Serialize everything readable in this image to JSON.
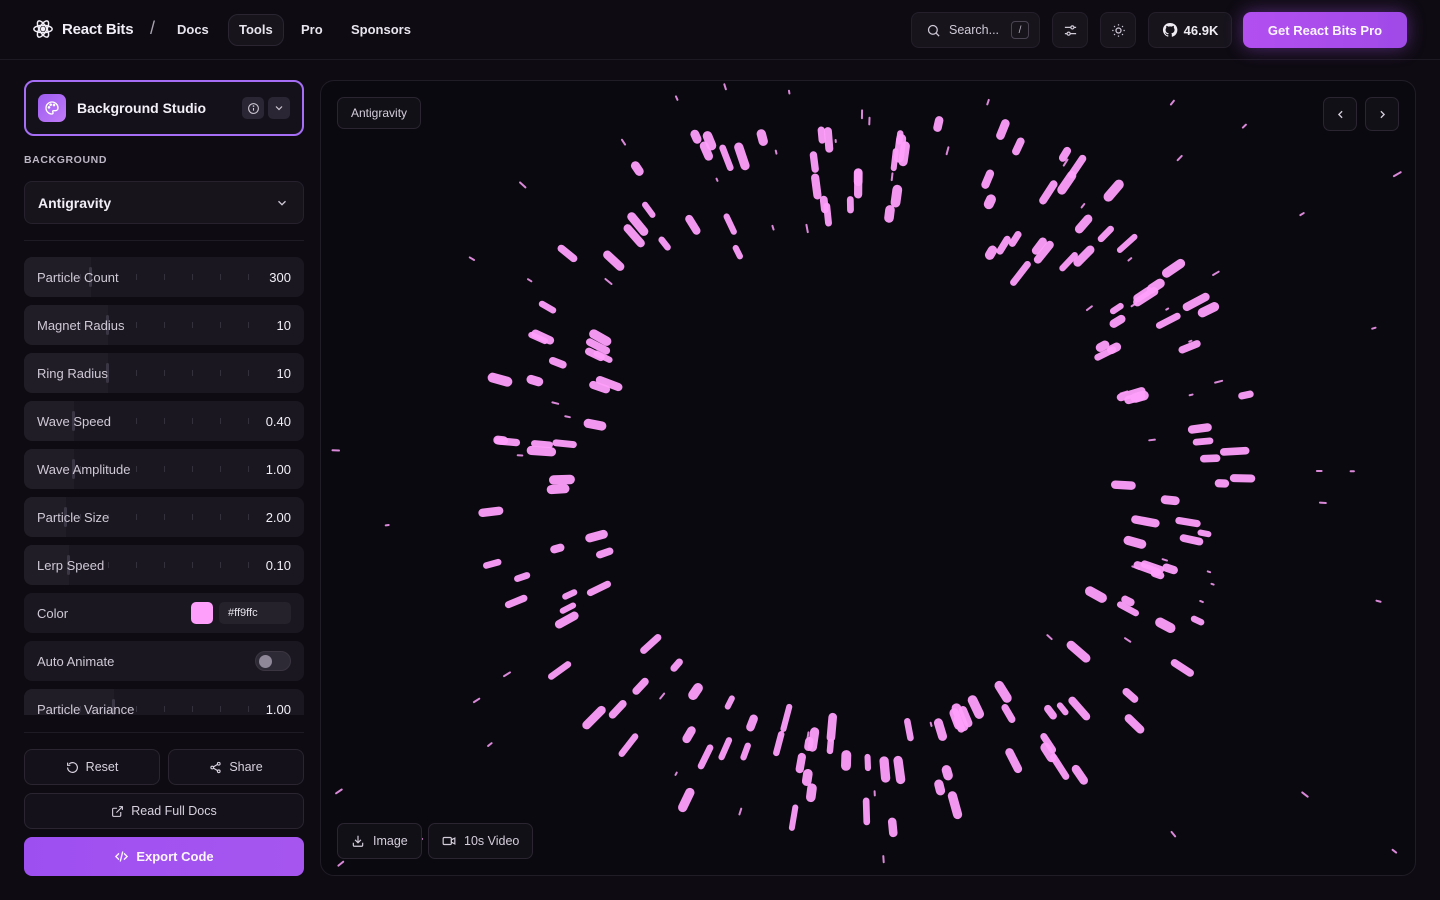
{
  "nav": {
    "brand": "React Bits",
    "separator": "/",
    "links": [
      "Docs",
      "Tools",
      "Pro",
      "Sponsors"
    ],
    "active_link": "Tools",
    "search_placeholder": "Search...",
    "search_shortcut": "/",
    "github_stars": "46.9K",
    "cta": "Get React Bits Pro"
  },
  "sidebar": {
    "studio_title": "Background Studio",
    "section_label": "BACKGROUND",
    "selected_background": "Antigravity",
    "controls": [
      {
        "label": "Particle Count",
        "value": "300",
        "fraction": 0.24
      },
      {
        "label": "Magnet Radius",
        "value": "10",
        "fraction": 0.3
      },
      {
        "label": "Ring Radius",
        "value": "10",
        "fraction": 0.3
      },
      {
        "label": "Wave Speed",
        "value": "0.40",
        "fraction": 0.18
      },
      {
        "label": "Wave Amplitude",
        "value": "1.00",
        "fraction": 0.18
      },
      {
        "label": "Particle Size",
        "value": "2.00",
        "fraction": 0.15
      },
      {
        "label": "Lerp Speed",
        "value": "0.10",
        "fraction": 0.16
      }
    ],
    "color": {
      "label": "Color",
      "value": "#ff9ffc"
    },
    "auto_animate": {
      "label": "Auto Animate",
      "enabled": false
    },
    "particle_variance": {
      "label": "Particle Variance",
      "value": "1.00",
      "fraction": 0.32
    },
    "reset_label": "Reset",
    "share_label": "Share",
    "docs_label": "Read Full Docs",
    "export_label": "Export Code"
  },
  "preview": {
    "tag": "Antigravity",
    "image_label": "Image",
    "video_label": "10s Video",
    "particle_color": "#ff9ffc"
  },
  "colors": {
    "accent": "#a56ef5",
    "cta": "#b34ff0",
    "background": "#0e0b12"
  }
}
